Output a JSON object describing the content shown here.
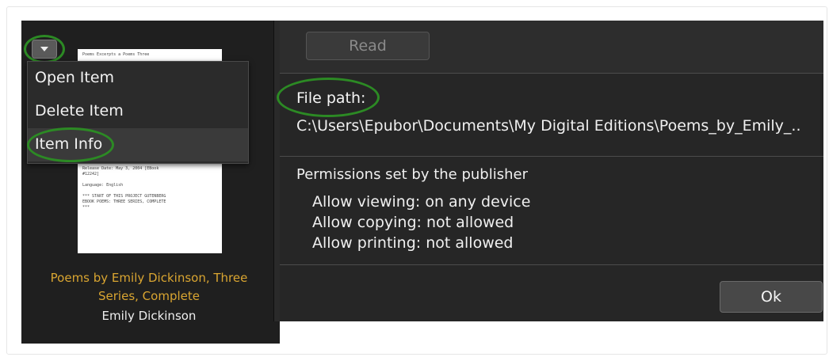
{
  "library": {
    "dropdown_icon": "triangle-down-icon",
    "thumbnail_lines": [
      "Poems Excerpts a Poems Three",
      "",
      "Release Date: May 3, 2004 [EBook",
      "#12242]",
      "",
      "Language: English",
      "",
      "*** START OF THIS PROJECT GUTENBERG",
      "EBOOK POEMS: THREE SERIES, COMPLETE",
      "***"
    ],
    "book_title": "Poems by Emily Dickinson, Three Series, Complete",
    "book_author": "Emily Dickinson"
  },
  "context_menu": {
    "items": [
      {
        "label": "Open Item"
      },
      {
        "label": "Delete Item"
      },
      {
        "label": "Item Info"
      }
    ]
  },
  "info_panel": {
    "read_button": "Read",
    "file_path_label": "File path:",
    "file_path_value": "C:\\Users\\Epubor\\Documents\\My Digital Editions\\Poems_by_Emily_..",
    "permissions_title": "Permissions set by the publisher",
    "permissions": [
      "Allow viewing: on any device",
      "Allow copying: not allowed",
      "Allow printing: not allowed"
    ],
    "ok_button": "Ok"
  },
  "colors": {
    "highlight": "#2c8a24",
    "title_accent": "#d9a531",
    "panel_bg": "#262626"
  }
}
